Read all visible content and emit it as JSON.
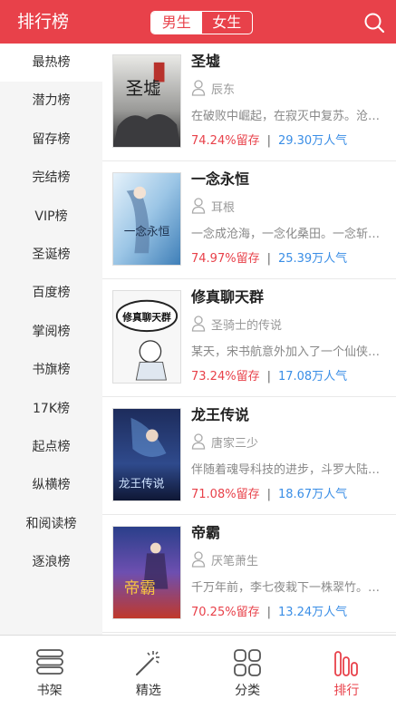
{
  "header": {
    "title": "排行榜",
    "tabs": [
      {
        "label": "男生",
        "active": true
      },
      {
        "label": "女生",
        "active": false
      }
    ],
    "search_icon": "search-icon",
    "accent_color": "#e8414a"
  },
  "sidebar": {
    "items": [
      {
        "label": "最热榜",
        "active": true
      },
      {
        "label": "潜力榜"
      },
      {
        "label": "留存榜"
      },
      {
        "label": "完结榜"
      },
      {
        "label": "VIP榜"
      },
      {
        "label": "圣诞榜"
      },
      {
        "label": "百度榜"
      },
      {
        "label": "掌阅榜"
      },
      {
        "label": "书旗榜"
      },
      {
        "label": "17K榜"
      },
      {
        "label": "起点榜"
      },
      {
        "label": "纵横榜"
      },
      {
        "label": "和阅读榜"
      },
      {
        "label": "逐浪榜"
      }
    ]
  },
  "books": [
    {
      "title": "圣墟",
      "author": "辰东",
      "desc": "在破败中崛起，在寂灭中复苏。沧海成尘",
      "retention": "74.24%留存",
      "separator": "|",
      "popularity": "29.30万人气",
      "cover_text": "圣墟"
    },
    {
      "title": "一念永恒",
      "author": "耳根",
      "desc": "一念成沧海，一念化桑田。一念斩千魔",
      "retention": "74.97%留存",
      "separator": "|",
      "popularity": "25.39万人气",
      "cover_text": "一念永恒"
    },
    {
      "title": "修真聊天群",
      "author": "圣骑士的传说",
      "desc": "某天，宋书航意外加入了一个仙侠中二病",
      "retention": "73.24%留存",
      "separator": "|",
      "popularity": "17.08万人气",
      "cover_text": "修真聊天群"
    },
    {
      "title": "龙王传说",
      "author": "唐家三少",
      "desc": "伴随着魂导科技的进步，斗罗大陆上的人",
      "retention": "71.08%留存",
      "separator": "|",
      "popularity": "18.67万人气",
      "cover_text": "龙王传说"
    },
    {
      "title": "帝霸",
      "author": "厌笔萧生",
      "desc": "千万年前，李七夜栽下一株翠竹。八百万",
      "retention": "70.25%留存",
      "separator": "|",
      "popularity": "13.24万人气",
      "cover_text": "帝霸"
    }
  ],
  "bottom_nav": [
    {
      "label": "书架",
      "icon": "bookshelf-icon"
    },
    {
      "label": "精选",
      "icon": "magic-wand-icon"
    },
    {
      "label": "分类",
      "icon": "grid-icon"
    },
    {
      "label": "排行",
      "icon": "ranking-bars-icon",
      "active": true
    }
  ]
}
